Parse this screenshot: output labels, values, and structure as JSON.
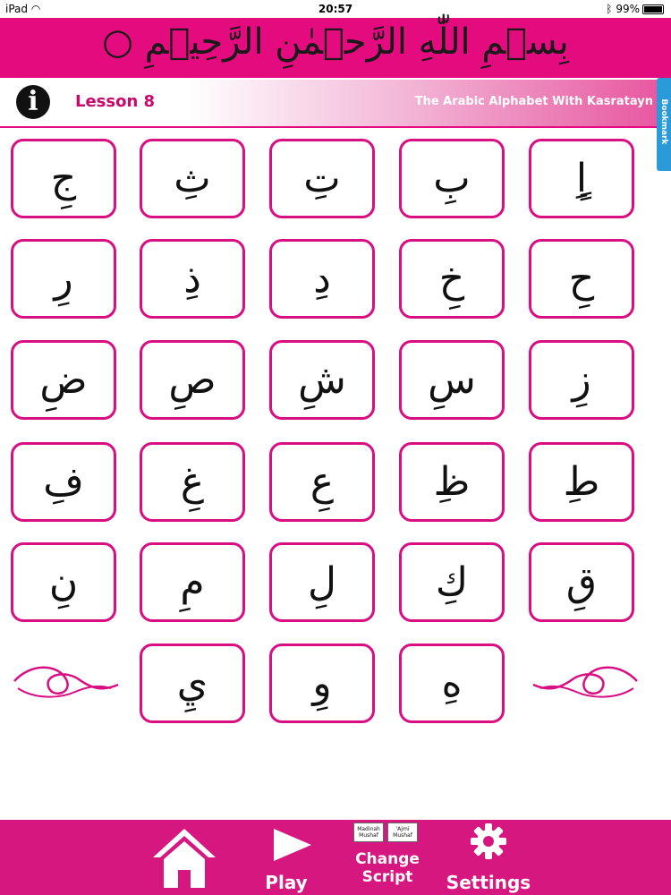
{
  "status_bar": {
    "device": "iPad",
    "time": "20:57",
    "battery": "99%"
  },
  "header": {
    "bismillah": "بِسۡمِ اللّٰهِ الرَّحۡمٰنِ الرَّحِيۡمِ ○"
  },
  "lesson": {
    "title": "Lesson 8",
    "subtitle": "The Arabic Alphabet With Kasratayn",
    "bookmark": "Bookmark"
  },
  "info_icon": "i",
  "letters": [
    "ٍاِ",
    "بِ",
    "تِ",
    "ثِ",
    "جِ",
    "حِ",
    "خِ",
    "دِ",
    "ذِ",
    "رِ",
    "زِ",
    "سِ",
    "شِ",
    "صِ",
    "ضِ",
    "طِ",
    "ظِ",
    "عِ",
    "غِ",
    "فِ",
    "قِ",
    "كِ",
    "لِ",
    "مِ",
    "نِ",
    "هِ",
    "وِ",
    "يِ"
  ],
  "nav": {
    "home": "",
    "play": "Play",
    "change_script": "Change Script",
    "madinah_mushaf": "Madinah Mushaf",
    "ajmi_mushaf": "'Ajmi Mushaf",
    "settings": "Settings"
  },
  "colors": {
    "brand": "#e30b7e",
    "tile_border": "#d80e82",
    "bottom": "#d6177f",
    "bookmark": "#2a9bd8"
  }
}
